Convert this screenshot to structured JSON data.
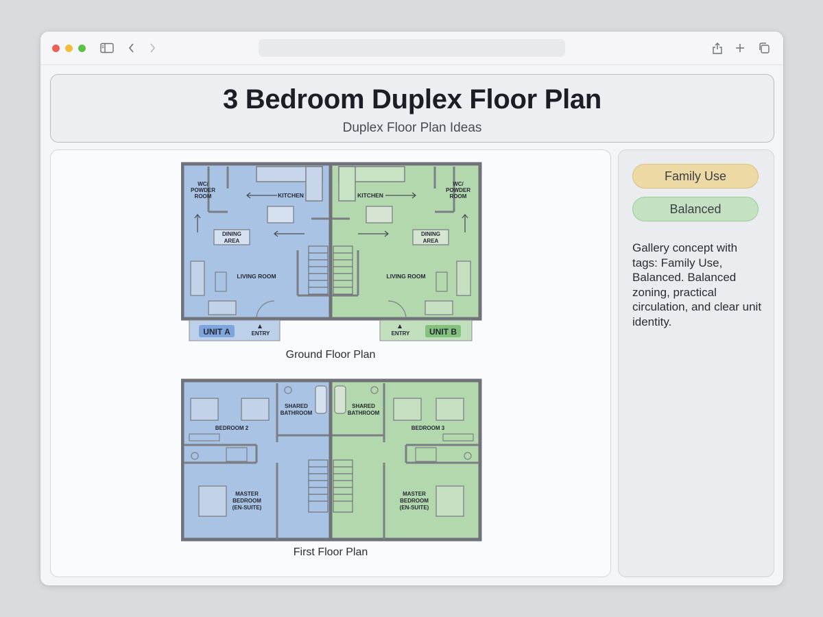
{
  "page": {
    "title": "3 Bedroom Duplex Floor Plan",
    "subtitle": "Duplex Floor Plan Ideas"
  },
  "tags": [
    "Family Use",
    "Balanced"
  ],
  "description": "Gallery concept with tags: Family Use, Balanced. Balanced zoning, practical circulation, and clear unit identity.",
  "ground_floor": {
    "caption": "Ground Floor Plan",
    "unit_a": {
      "badge": "UNIT A",
      "wc": [
        "WC/",
        "POWDER",
        "ROOM"
      ],
      "kitchen": "KITCHEN",
      "dining": [
        "DINING",
        "AREA"
      ],
      "living": "LIVING ROOM",
      "entry": "ENTRY"
    },
    "unit_b": {
      "badge": "UNIT B",
      "wc": [
        "WC/",
        "POWDER",
        "ROOM"
      ],
      "kitchen": "KITCHEN",
      "dining": [
        "DINING",
        "AREA"
      ],
      "living": "LIVING ROOM",
      "entry": "ENTRY"
    }
  },
  "first_floor": {
    "caption": "First Floor Plan",
    "unit_a": {
      "bedroom": "BEDROOM 2",
      "bathroom": [
        "SHARED",
        "BATHROOM"
      ],
      "master": [
        "MASTER",
        "BEDROOM",
        "(EN-SUITE)"
      ]
    },
    "unit_b": {
      "bedroom": "BEDROOM 3",
      "bathroom": [
        "SHARED",
        "BATHROOM"
      ],
      "master": [
        "MASTER",
        "BEDROOM",
        "(EN-SUITE)"
      ]
    }
  },
  "colors": {
    "unit_a_fill": "#a9c3e4",
    "unit_b_fill": "#b3d8ae",
    "wall": "#6f7278",
    "tag_family": "#ecd9a4",
    "tag_balanced": "#c4e2c2"
  },
  "icons": [
    "sidebar-icon",
    "back-arrow-icon",
    "forward-arrow-icon",
    "share-icon",
    "plus-icon",
    "tabs-icon"
  ]
}
